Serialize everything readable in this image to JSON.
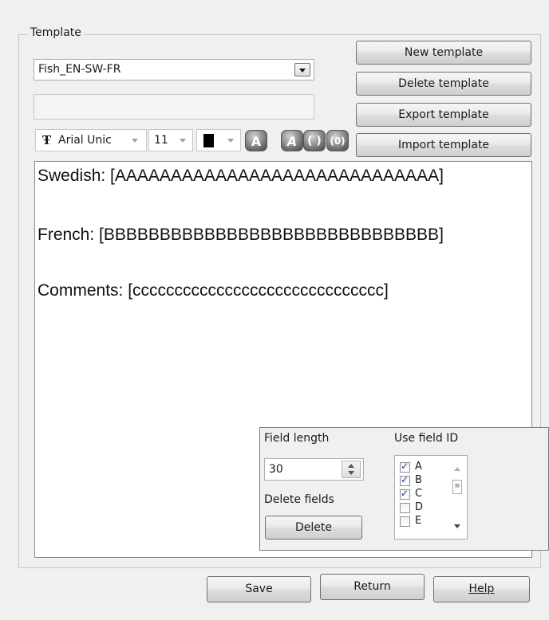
{
  "template_group": {
    "title": "Template",
    "selected_template": "Fish_EN-SW-FR",
    "name_field_value": "",
    "buttons": {
      "new": "New template",
      "delete": "Delete template",
      "export": "Export template",
      "import": "Import template"
    }
  },
  "toolbar": {
    "font_name": "Arial Unic",
    "font_size": "11",
    "font_color": "#000000",
    "format_buttons": [
      {
        "label": "A",
        "icon": "bold-icon"
      },
      {
        "label": "A",
        "icon": "italic-icon"
      },
      {
        "label": "( )",
        "icon": "brackets-icon"
      },
      {
        "label": "(0)",
        "icon": "field-brackets-icon"
      }
    ]
  },
  "editor": {
    "lines": [
      "Swedish: [AAAAAAAAAAAAAAAAAAAAAAAAAAAAA]",
      "French: [BBBBBBBBBBBBBBBBBBBBBBBBBBBBBB]",
      "Comments: [cccccccccccccccccccccccccccccc]"
    ]
  },
  "field_panel": {
    "field_length_label": "Field length",
    "field_length_value": "30",
    "delete_fields_label": "Delete fields",
    "delete_button": "Delete",
    "use_field_id_label": "Use field ID",
    "field_ids": [
      {
        "id": "A",
        "checked": true
      },
      {
        "id": "B",
        "checked": true
      },
      {
        "id": "C",
        "checked": true
      },
      {
        "id": "D",
        "checked": false
      },
      {
        "id": "E",
        "checked": false
      }
    ]
  },
  "footer": {
    "save": "Save",
    "return": "Return",
    "help": "Help"
  }
}
